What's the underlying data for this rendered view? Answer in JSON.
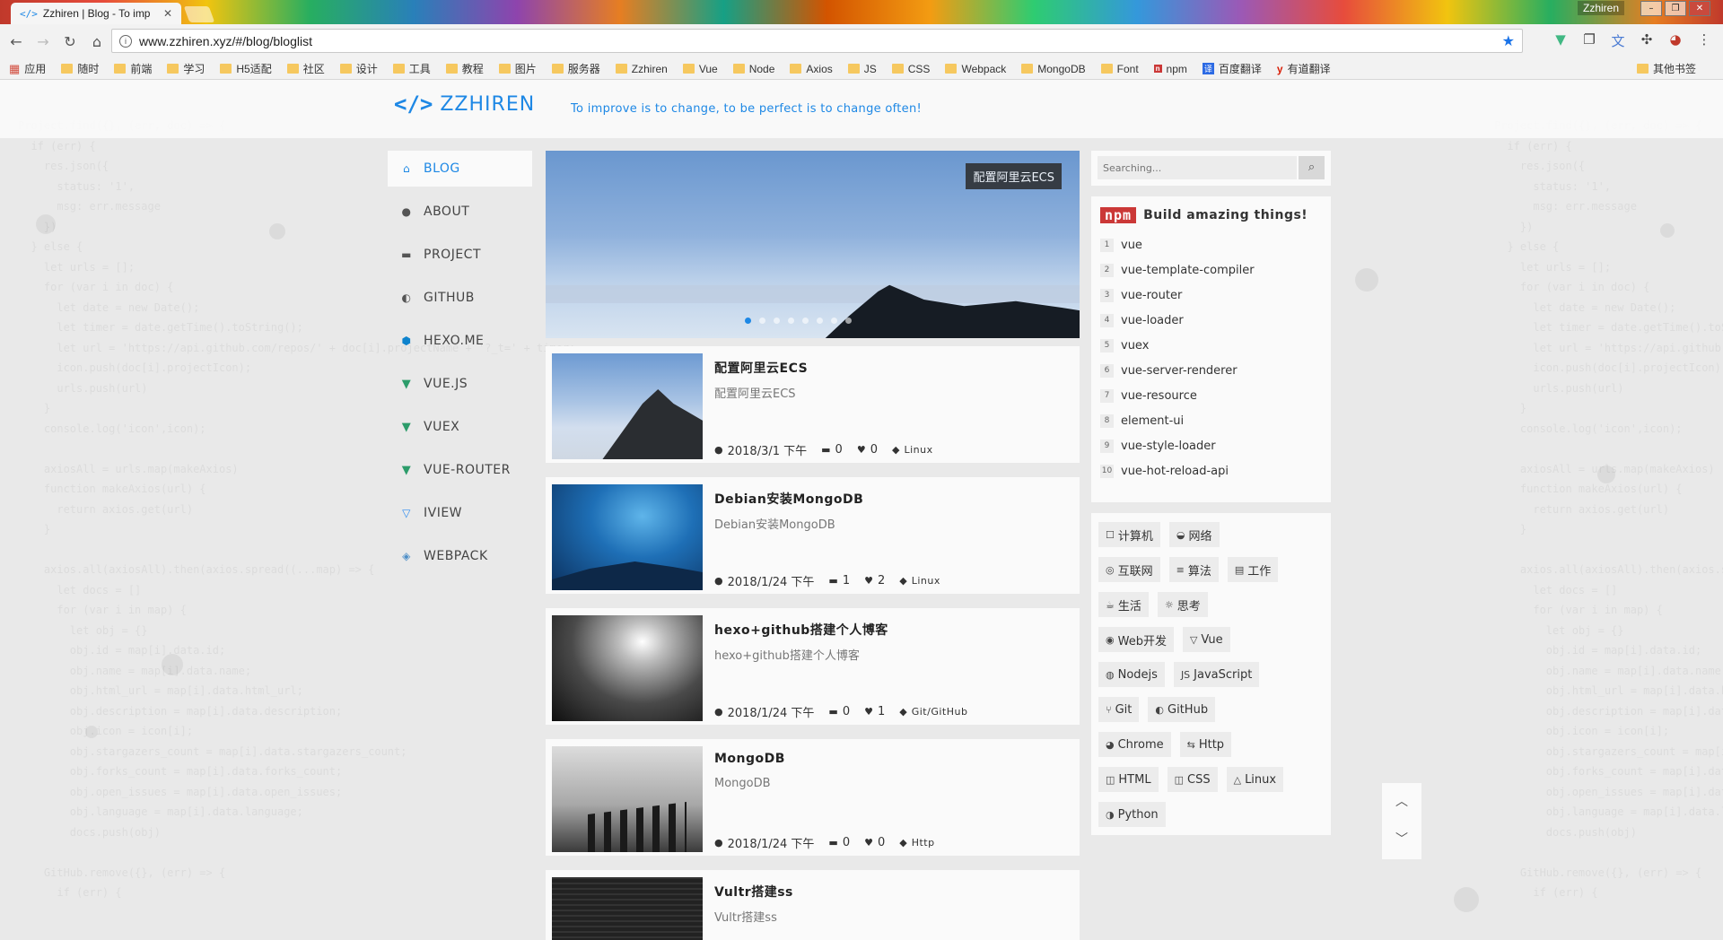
{
  "browser": {
    "tab_title": "Zzhiren | Blog - To imp",
    "url": "www.zzhiren.xyz/#/blog/bloglist",
    "window_user": "Zzhiren",
    "bookmarks": [
      "应用",
      "随时",
      "前端",
      "学习",
      "H5适配",
      "社区",
      "设计",
      "工具",
      "教程",
      "图片",
      "服务器",
      "Zzhiren",
      "Vue",
      "Node",
      "Axios",
      "JS",
      "CSS",
      "Webpack",
      "MongoDB",
      "Font",
      "npm",
      "百度翻译",
      "有道翻译"
    ],
    "other_bookmarks": "其他书签"
  },
  "site": {
    "logo_text": "ZZHIREN",
    "slogan": "To improve is to change, to be perfect is to change often!"
  },
  "nav": [
    {
      "label": "BLOG",
      "icon": "home-icon"
    },
    {
      "label": "ABOUT",
      "icon": "user-icon"
    },
    {
      "label": "PROJECT",
      "icon": "folder-icon"
    },
    {
      "label": "GITHUB",
      "icon": "github-icon"
    },
    {
      "label": "HEXO.ME",
      "icon": "hexo-icon"
    },
    {
      "label": "VUE.JS",
      "icon": "vue-icon"
    },
    {
      "label": "VUEX",
      "icon": "vue-icon"
    },
    {
      "label": "VUE-ROUTER",
      "icon": "vue-icon"
    },
    {
      "label": "IVIEW",
      "icon": "iview-icon"
    },
    {
      "label": "WEBPACK",
      "icon": "webpack-icon"
    }
  ],
  "carousel": {
    "caption": "配置阿里云ECS",
    "slide_count": 8,
    "active_index": 0
  },
  "posts": [
    {
      "title": "配置阿里云ECS",
      "desc": "配置阿里云ECS",
      "date": "2018/3/1 下午",
      "comments": "0",
      "likes": "0",
      "tag": "Linux"
    },
    {
      "title": "Debian安装MongoDB",
      "desc": "Debian安装MongoDB",
      "date": "2018/1/24 下午",
      "comments": "1",
      "likes": "2",
      "tag": "Linux"
    },
    {
      "title": "hexo+github搭建个人博客",
      "desc": "hexo+github搭建个人博客",
      "date": "2018/1/24 下午",
      "comments": "0",
      "likes": "1",
      "tag": "Git/GitHub"
    },
    {
      "title": "MongoDB",
      "desc": "MongoDB",
      "date": "2018/1/24 下午",
      "comments": "0",
      "likes": "0",
      "tag": "Http"
    },
    {
      "title": "Vultr搭建ss",
      "desc": "Vultr搭建ss"
    }
  ],
  "search": {
    "placeholder": "Searching..."
  },
  "npm": {
    "logo": "npm",
    "title": "Build amazing things!",
    "packages": [
      "vue",
      "vue-template-compiler",
      "vue-router",
      "vue-loader",
      "vuex",
      "vue-server-renderer",
      "vue-resource",
      "element-ui",
      "vue-style-loader",
      "vue-hot-reload-api"
    ]
  },
  "tags": [
    [
      "计算机",
      "网络"
    ],
    [
      "互联网",
      "算法",
      "工作"
    ],
    [
      "生活",
      "思考"
    ],
    [
      "Web开发",
      "Vue"
    ],
    [
      "Nodejs",
      "JavaScript"
    ],
    [
      "Git",
      "GitHub"
    ],
    [
      "Chrome",
      "Http"
    ],
    [
      "HTML",
      "CSS",
      "Linux"
    ],
    [
      "Python"
    ]
  ],
  "tag_icons": {
    "计算机": "☐",
    "网络": "◒",
    "互联网": "◎",
    "算法": "≡",
    "工作": "▤",
    "生活": "☕",
    "思考": "☼",
    "Web开发": "◉",
    "Vue": "▽",
    "Nodejs": "◍",
    "JavaScript": "JS",
    "Git": "⑂",
    "GitHub": "◐",
    "Chrome": "◕",
    "Http": "⇆",
    "HTML": "◫",
    "CSS": "◫",
    "Linux": "△",
    "Python": "◑"
  },
  "colors": {
    "accent": "#1e88e5",
    "npm_red": "#cb3837"
  }
}
